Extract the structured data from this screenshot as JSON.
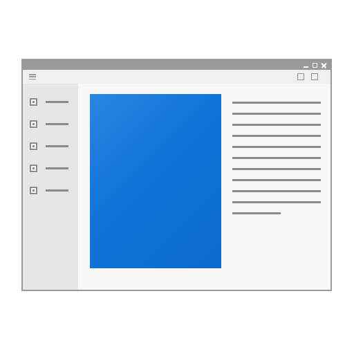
{
  "window": {
    "titlebar": {
      "controls": [
        "minimize-icon",
        "maximize-icon",
        "close-icon"
      ]
    },
    "toolbar": {
      "icons": [
        "menu-icon",
        "square-icon",
        "square-icon"
      ]
    },
    "sidebar": {
      "items": [
        {
          "icon": "checkbox-icon"
        },
        {
          "icon": "checkbox-icon"
        },
        {
          "icon": "checkbox-icon"
        },
        {
          "icon": "checkbox-icon"
        },
        {
          "icon": "checkbox-icon"
        }
      ]
    },
    "content": {
      "image": "image-placeholder",
      "text_lines": 11
    },
    "colors": {
      "frame": "#9a9a9a",
      "accent": "#0f73d8",
      "lines": "#8a8a8a",
      "sidebar": "#e6e6e6",
      "content": "#f7f7f7"
    }
  }
}
